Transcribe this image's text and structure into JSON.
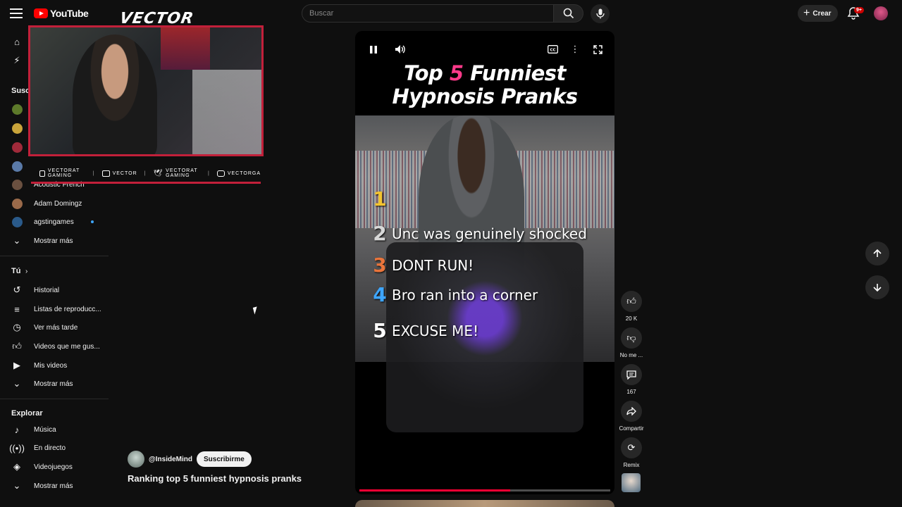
{
  "topbar": {
    "logo_text": "YouTube",
    "search_placeholder": "Buscar",
    "create_label": "Crear",
    "notif_badge": "9+"
  },
  "sidebar": {
    "subscriptions_header": "Susc",
    "channels": [
      {
        "name": "Acoustic French"
      },
      {
        "name": "Adam Domingz"
      },
      {
        "name": "agstingames"
      }
    ],
    "show_more_1": "Mostrar más",
    "you_header": "Tú",
    "you_items": [
      {
        "label": "Historial"
      },
      {
        "label": "Listas de reproducc..."
      },
      {
        "label": "Ver más tarde"
      },
      {
        "label": "Videos que me gus..."
      },
      {
        "label": "Mis videos"
      }
    ],
    "show_more_2": "Mostrar más",
    "explore_header": "Explorar",
    "explore_items": [
      {
        "label": "Música"
      },
      {
        "label": "En directo"
      },
      {
        "label": "Videojuegos"
      }
    ],
    "show_more_3": "Mostrar más"
  },
  "overlay": {
    "brand": "VECTOR",
    "socials": [
      {
        "label": "VECTORAT GAMING"
      },
      {
        "label": "VECTOR"
      },
      {
        "label": "VECTORAT GAMING"
      },
      {
        "label": "VECTORGA"
      }
    ]
  },
  "video": {
    "title_line1_a": "Top ",
    "title_line1_num": "5",
    "title_line1_b": " Funniest",
    "title_line2": "Hypnosis Pranks",
    "ranks": [
      {
        "num": "1",
        "text": "",
        "color": "#f4c430"
      },
      {
        "num": "2",
        "text": "Unc was genuinely shocked",
        "color": "#d8d8d8"
      },
      {
        "num": "3",
        "text": "DONT RUN!",
        "color": "#e8743b"
      },
      {
        "num": "4",
        "text": "Bro ran into a corner",
        "color": "#3ea6ff"
      },
      {
        "num": "5",
        "text": "EXCUSE ME!",
        "color": "#ffffff"
      }
    ],
    "progress_fraction": 0.6
  },
  "channel": {
    "handle": "@InsideMind",
    "subscribe_label": "Suscribirme",
    "video_title": "Ranking top 5 funniest hypnosis pranks"
  },
  "actions": {
    "likes": "20 K",
    "dislike_label": "No me ...",
    "comments": "167",
    "share_label": "Compartir",
    "remix_label": "Remix"
  }
}
